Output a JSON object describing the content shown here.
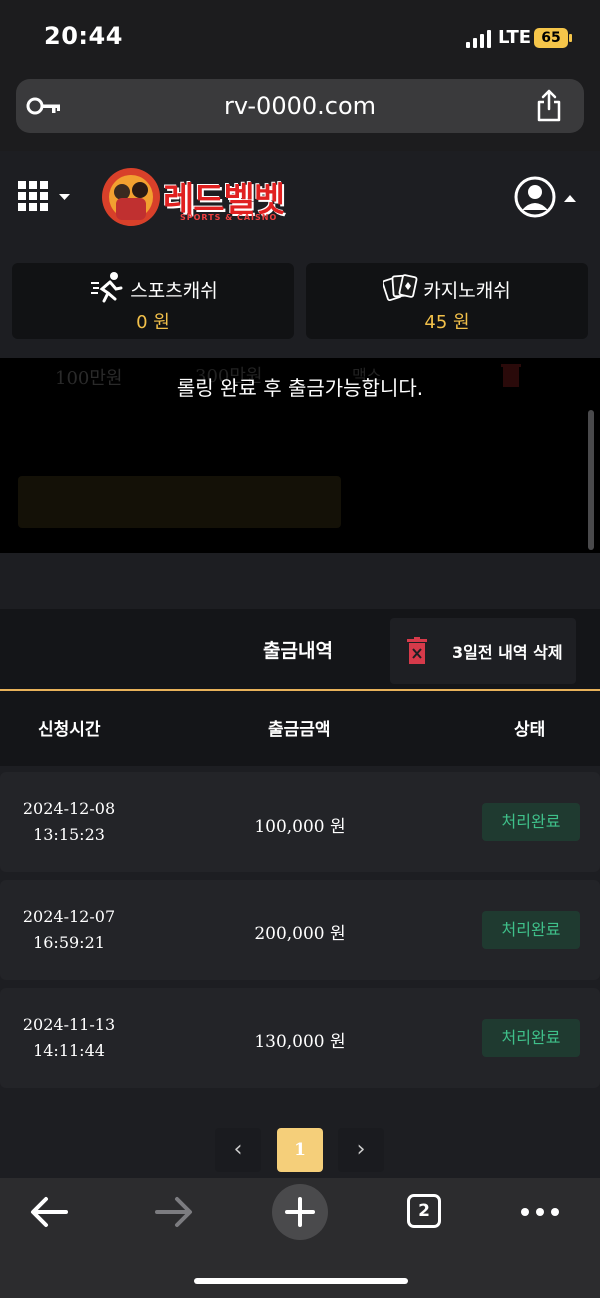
{
  "status_bar": {
    "time": "20:44",
    "network": "LTE",
    "battery": "65"
  },
  "browser": {
    "url": "rv-0000.com",
    "tab_count": "2"
  },
  "site": {
    "logo_text": "레드벨벳",
    "logo_subtitle": "SPORTS & CAISNO",
    "sports_cash_label": "스포츠캐쉬",
    "sports_cash_value": "0 원",
    "casino_cash_label": "카지노캐쉬",
    "casino_cash_value": "45 원"
  },
  "overlay": {
    "notice": "롤링 완료 후 출금가능합니다.",
    "background_options": [
      "100만원",
      "300만원",
      "맥스"
    ]
  },
  "history": {
    "title": "출금내역",
    "delete_label": "3일전 내역 삭제",
    "columns": [
      "신청시간",
      "출금금액",
      "상태"
    ],
    "rows": [
      {
        "date": "2024-12-08",
        "time": "13:15:23",
        "amount": "100,000 원",
        "status": "처리완료"
      },
      {
        "date": "2024-12-07",
        "time": "16:59:21",
        "amount": "200,000 원",
        "status": "처리완료"
      },
      {
        "date": "2024-11-13",
        "time": "14:11:44",
        "amount": "130,000 원",
        "status": "처리완료"
      }
    ]
  },
  "pagination": {
    "prev": "‹",
    "current": "1",
    "next": "›"
  },
  "colors": {
    "accent_gold": "#f2c04a",
    "status_green": "#3fc08a",
    "logo_red": "#e02020"
  },
  "icons": [
    "key-icon",
    "share-icon",
    "grid-menu-icon",
    "caret-down-icon",
    "user-icon",
    "caret-up-icon",
    "runner-icon",
    "cards-icon",
    "trash-icon",
    "back-arrow-icon",
    "forward-arrow-icon",
    "plus-icon",
    "more-icon"
  ]
}
